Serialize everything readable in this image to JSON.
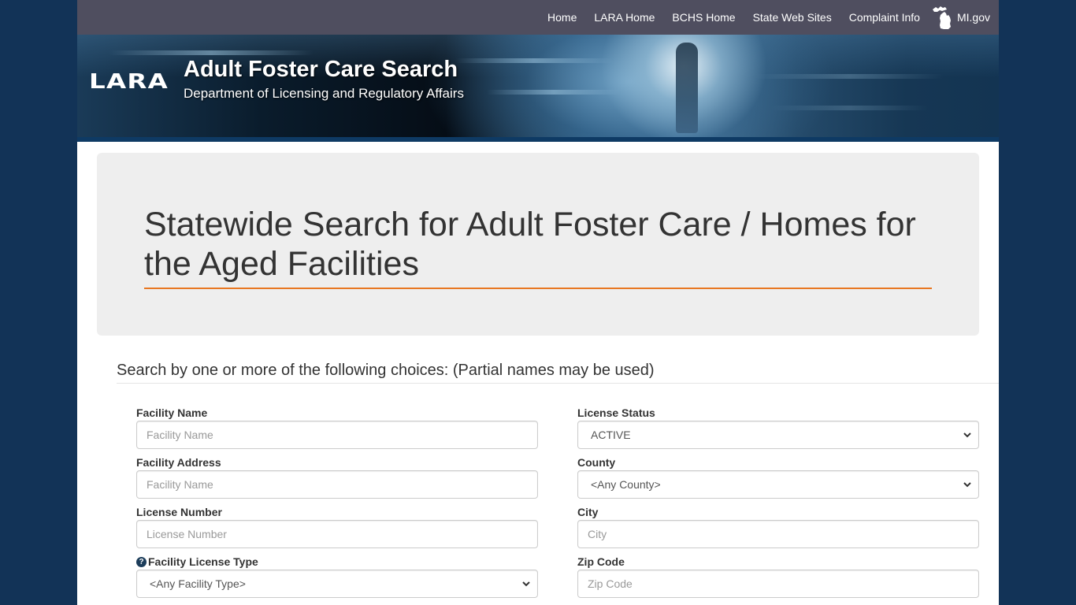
{
  "topnav": {
    "links": [
      {
        "label": "Home"
      },
      {
        "label": "LARA Home"
      },
      {
        "label": "BCHS Home"
      },
      {
        "label": "State Web Sites"
      },
      {
        "label": "Complaint Info"
      }
    ],
    "migov_label": "MI.gov",
    "migov_icon": "michigan-map-icon"
  },
  "banner": {
    "logo": "LARA",
    "title": "Adult Foster Care Search",
    "subtitle": "Department of Licensing and Regulatory Affairs"
  },
  "jumbotron": {
    "heading": "Statewide Search for Adult Foster Care / Homes for the Aged Facilities",
    "accent_color": "#e87722"
  },
  "search": {
    "instruction": "Search by one or more of the following choices: (Partial names may be used)",
    "fields": {
      "facility_name": {
        "label": "Facility Name",
        "placeholder": "Facility Name",
        "value": ""
      },
      "facility_address": {
        "label": "Facility Address",
        "placeholder": "Facility Name",
        "value": ""
      },
      "license_number": {
        "label": "License Number",
        "placeholder": "License Number",
        "value": ""
      },
      "facility_license_type": {
        "label": "Facility License Type",
        "selected": "<Any Facility Type>",
        "help_icon": "question-circle-icon"
      },
      "license_status": {
        "label": "License Status",
        "selected": "ACTIVE"
      },
      "county": {
        "label": "County",
        "selected": "<Any County>"
      },
      "city": {
        "label": "City",
        "placeholder": "City",
        "value": ""
      },
      "zip_code": {
        "label": "Zip Code",
        "placeholder": "Zip Code",
        "value": ""
      }
    }
  },
  "colors": {
    "background": "#123357",
    "nav_bar": "#4f4e5f",
    "accent": "#e87722",
    "jumbotron_bg": "#eeeeee"
  }
}
